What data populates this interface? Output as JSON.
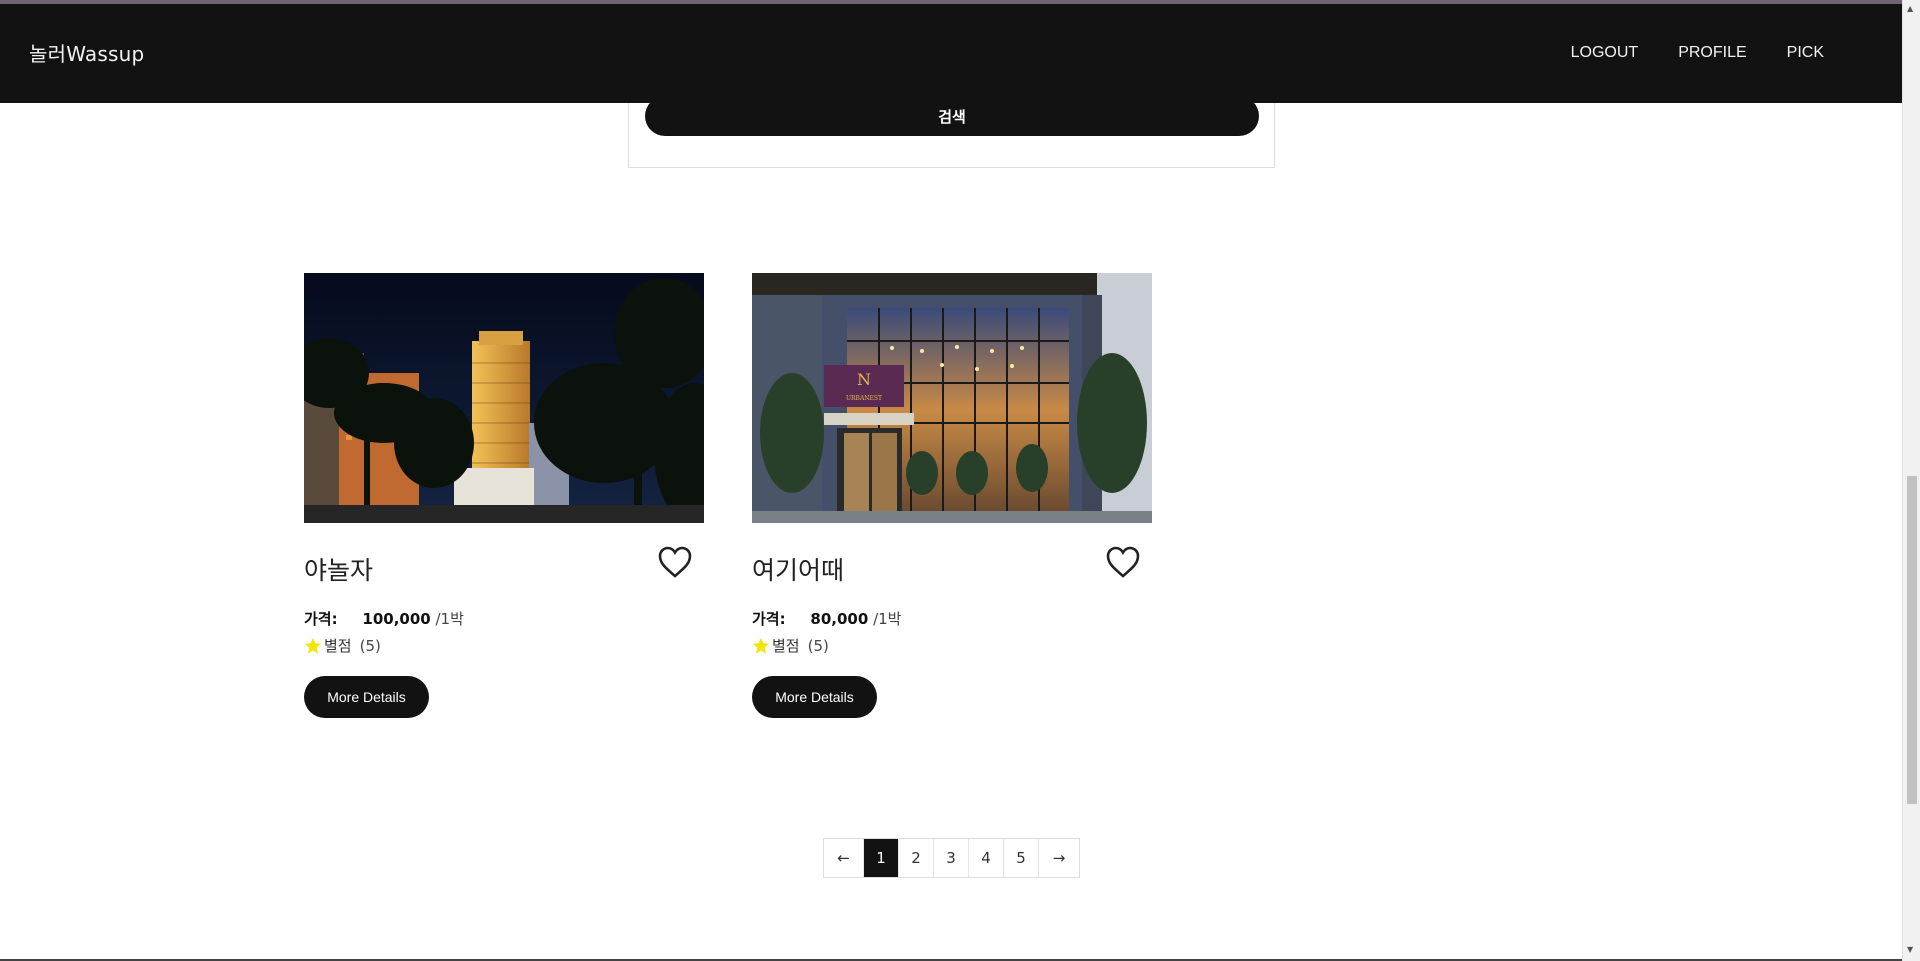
{
  "header": {
    "brand": "놀러Wassup",
    "nav": [
      "LOGOUT",
      "PROFILE",
      "PICK"
    ]
  },
  "search": {
    "button_label": "검색"
  },
  "listings": [
    {
      "title": "야놀자",
      "price_label": "가격:",
      "price": "100,000",
      "price_unit": "/1박",
      "rating_label": "별점",
      "rating_count": "(5)",
      "button_label": "More Details",
      "image": "hotel-night-image"
    },
    {
      "title": "여기어때",
      "price_label": "가격:",
      "price": "80,000",
      "price_unit": "/1박",
      "rating_label": "별점",
      "rating_count": "(5)",
      "button_label": "More Details",
      "image": "hotel-entrance-image",
      "sign_text": "URBANEST"
    }
  ],
  "pagination": {
    "prev": "←",
    "next": "→",
    "pages": [
      "1",
      "2",
      "3",
      "4",
      "5"
    ],
    "current": "1"
  },
  "colors": {
    "navbar": "#121212",
    "button": "#121212",
    "star": "#f5e300"
  }
}
